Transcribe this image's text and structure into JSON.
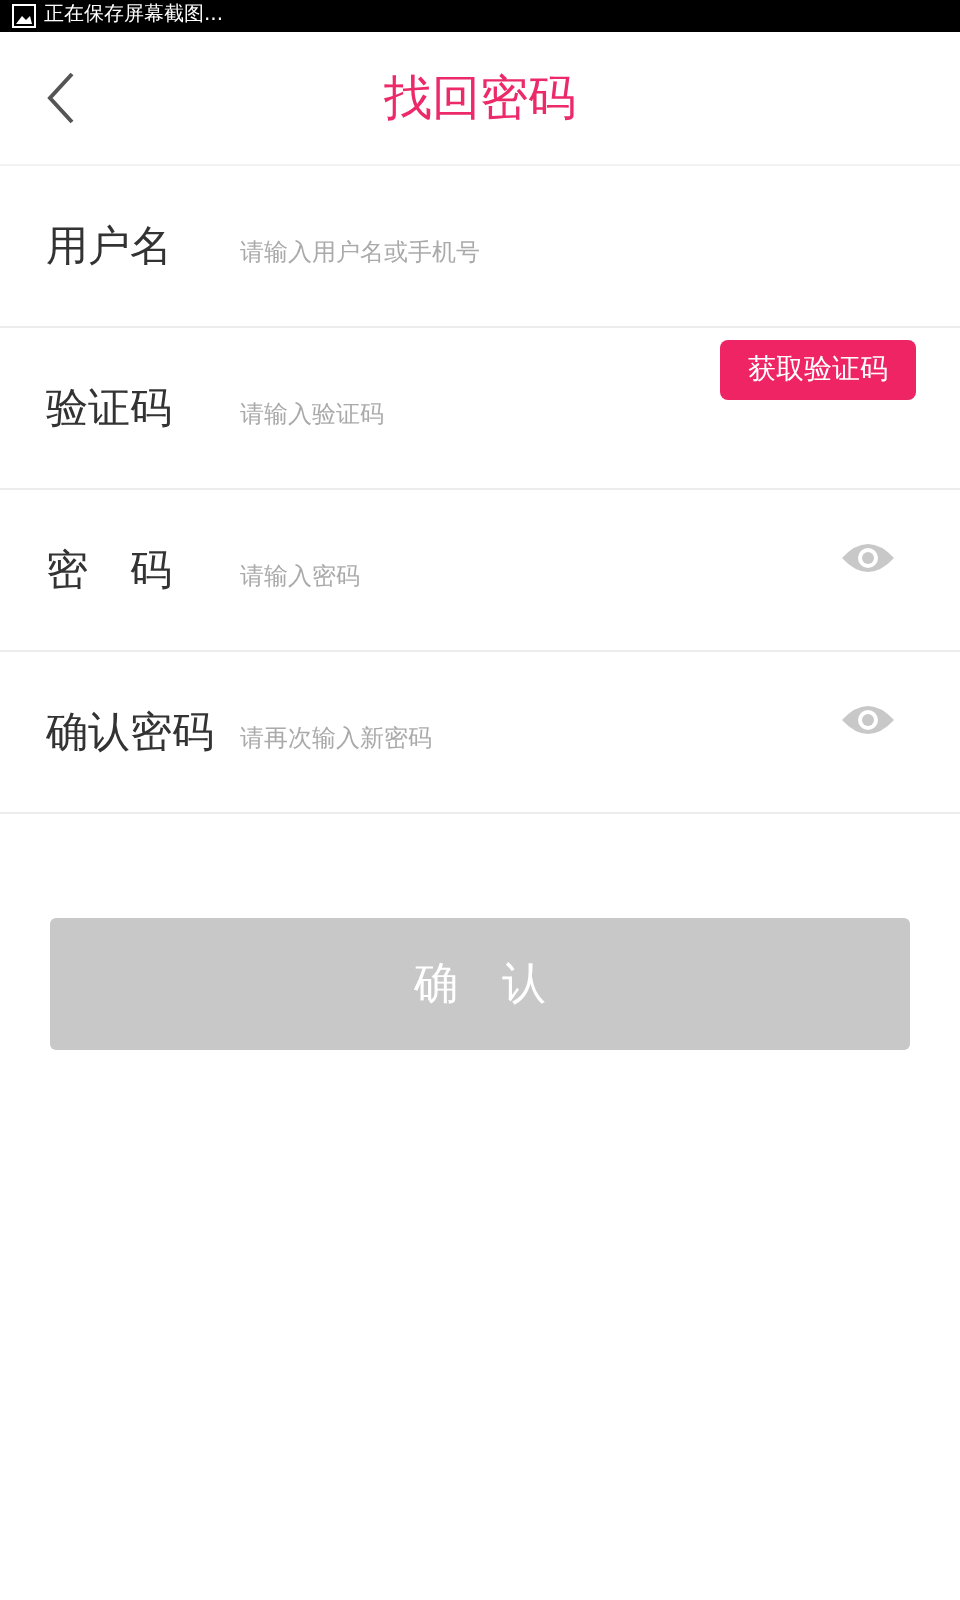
{
  "status_bar": {
    "notification": "正在保存屏幕截图..."
  },
  "header": {
    "title": "找回密码"
  },
  "fields": [
    {
      "kind": "text",
      "label": "用户名",
      "placeholder": "请输入用户名或手机号"
    },
    {
      "kind": "code",
      "label": "验证码",
      "placeholder": "请输入验证码",
      "action": "获取验证码"
    },
    {
      "kind": "password",
      "label": "密　码",
      "placeholder": "请输入密码"
    },
    {
      "kind": "password",
      "label": "确认密码",
      "placeholder": "请再次输入新密码"
    }
  ],
  "submit": {
    "label": "确　认",
    "disabled": true
  }
}
